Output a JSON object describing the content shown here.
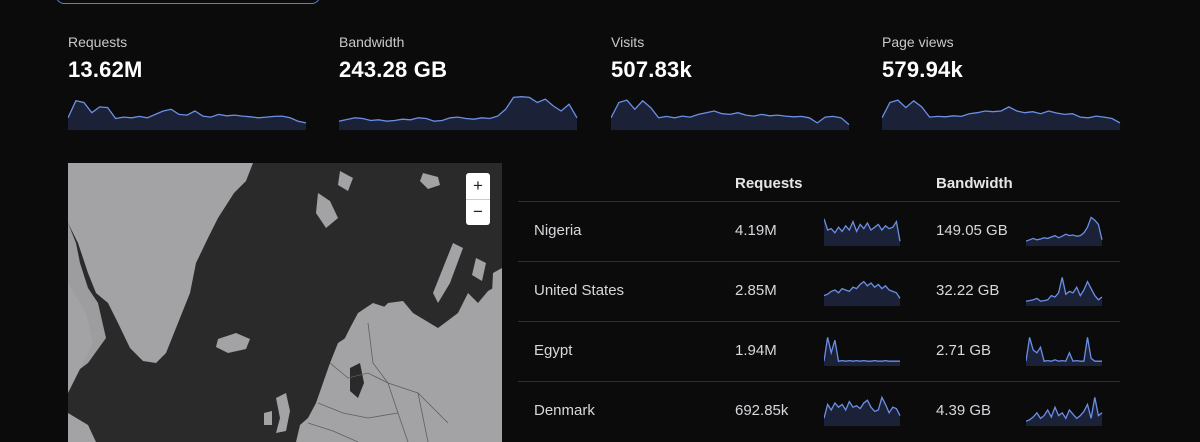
{
  "colors": {
    "accent": "#6b8fe6",
    "background": "#0b0b0c",
    "land": "#a3a3a6",
    "water": "#2a2a2b",
    "divider": "#2f2f33"
  },
  "stats": [
    {
      "label": "Requests",
      "value": "13.62M",
      "spark": [
        0.3,
        0.8,
        0.75,
        0.45,
        0.62,
        0.6,
        0.28,
        0.32,
        0.3,
        0.34,
        0.3,
        0.4,
        0.5,
        0.55,
        0.4,
        0.38,
        0.5,
        0.35,
        0.32,
        0.4,
        0.36,
        0.38,
        0.35,
        0.33,
        0.3,
        0.32,
        0.34,
        0.35,
        0.3,
        0.2,
        0.15
      ]
    },
    {
      "label": "Bandwidth",
      "value": "243.28 GB",
      "spark": [
        0.2,
        0.25,
        0.3,
        0.28,
        0.22,
        0.24,
        0.2,
        0.22,
        0.26,
        0.24,
        0.3,
        0.28,
        0.2,
        0.22,
        0.3,
        0.32,
        0.28,
        0.26,
        0.3,
        0.28,
        0.35,
        0.55,
        0.9,
        0.92,
        0.9,
        0.75,
        0.85,
        0.65,
        0.5,
        0.7,
        0.3
      ]
    },
    {
      "label": "Visits",
      "value": "507.83k",
      "spark": [
        0.3,
        0.75,
        0.82,
        0.55,
        0.8,
        0.6,
        0.3,
        0.34,
        0.3,
        0.35,
        0.32,
        0.4,
        0.45,
        0.5,
        0.42,
        0.4,
        0.45,
        0.38,
        0.35,
        0.4,
        0.36,
        0.38,
        0.35,
        0.33,
        0.34,
        0.3,
        0.15,
        0.32,
        0.34,
        0.3,
        0.1
      ]
    },
    {
      "label": "Page views",
      "value": "579.94k",
      "spark": [
        0.3,
        0.75,
        0.82,
        0.6,
        0.8,
        0.62,
        0.32,
        0.34,
        0.33,
        0.36,
        0.34,
        0.42,
        0.45,
        0.5,
        0.48,
        0.5,
        0.62,
        0.5,
        0.45,
        0.48,
        0.42,
        0.5,
        0.44,
        0.4,
        0.42,
        0.32,
        0.3,
        0.35,
        0.32,
        0.28,
        0.15
      ]
    }
  ],
  "map": {
    "zoom_in": "+",
    "zoom_out": "−"
  },
  "table": {
    "headers": {
      "requests": "Requests",
      "bandwidth": "Bandwidth"
    },
    "rows": [
      {
        "country": "Nigeria",
        "requests": "4.19M",
        "bandwidth": "149.05 GB",
        "req_spark": [
          0.9,
          0.5,
          0.55,
          0.4,
          0.6,
          0.45,
          0.65,
          0.5,
          0.8,
          0.45,
          0.7,
          0.55,
          0.75,
          0.5,
          0.6,
          0.7,
          0.5,
          0.65,
          0.55,
          0.6,
          0.8,
          0.1
        ],
        "bw_spark": [
          0.1,
          0.15,
          0.2,
          0.15,
          0.18,
          0.22,
          0.2,
          0.25,
          0.3,
          0.22,
          0.28,
          0.35,
          0.3,
          0.32,
          0.28,
          0.3,
          0.4,
          0.6,
          0.95,
          0.85,
          0.7,
          0.15
        ]
      },
      {
        "country": "United States",
        "requests": "2.85M",
        "bandwidth": "32.22 GB",
        "req_spark": [
          0.3,
          0.35,
          0.45,
          0.5,
          0.4,
          0.55,
          0.5,
          0.45,
          0.6,
          0.55,
          0.7,
          0.8,
          0.65,
          0.75,
          0.6,
          0.7,
          0.55,
          0.65,
          0.5,
          0.45,
          0.4,
          0.2
        ],
        "bw_spark": [
          0.1,
          0.12,
          0.15,
          0.2,
          0.1,
          0.12,
          0.15,
          0.3,
          0.25,
          0.4,
          0.95,
          0.35,
          0.45,
          0.4,
          0.6,
          0.3,
          0.5,
          0.8,
          0.55,
          0.3,
          0.15,
          0.25
        ]
      },
      {
        "country": "Egypt",
        "requests": "1.94M",
        "bandwidth": "2.71 GB",
        "req_spark": [
          0.1,
          0.95,
          0.4,
          0.85,
          0.1,
          0.12,
          0.1,
          0.12,
          0.1,
          0.12,
          0.1,
          0.12,
          0.1,
          0.1,
          0.12,
          0.1,
          0.1,
          0.12,
          0.1,
          0.1,
          0.1,
          0.1
        ],
        "bw_spark": [
          0.1,
          0.95,
          0.5,
          0.4,
          0.6,
          0.1,
          0.12,
          0.1,
          0.15,
          0.1,
          0.12,
          0.1,
          0.4,
          0.1,
          0.12,
          0.1,
          0.1,
          0.95,
          0.2,
          0.1,
          0.1,
          0.1
        ]
      },
      {
        "country": "Denmark",
        "requests": "692.85k",
        "bandwidth": "4.39 GB",
        "req_spark": [
          0.2,
          0.7,
          0.5,
          0.75,
          0.6,
          0.7,
          0.5,
          0.8,
          0.6,
          0.65,
          0.55,
          0.75,
          0.85,
          0.6,
          0.45,
          0.5,
          0.95,
          0.7,
          0.4,
          0.6,
          0.55,
          0.3
        ],
        "bw_spark": [
          0.1,
          0.15,
          0.25,
          0.4,
          0.2,
          0.3,
          0.5,
          0.25,
          0.6,
          0.3,
          0.4,
          0.2,
          0.5,
          0.35,
          0.2,
          0.3,
          0.45,
          0.7,
          0.2,
          0.95,
          0.3,
          0.4
        ]
      }
    ]
  }
}
